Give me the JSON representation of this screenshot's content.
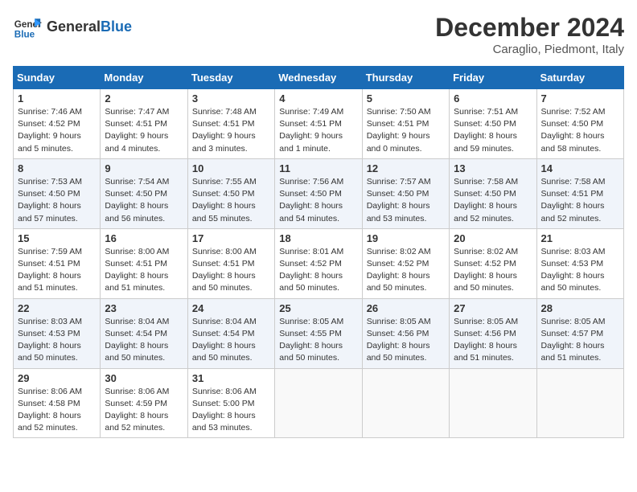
{
  "logo": {
    "text_general": "General",
    "text_blue": "Blue"
  },
  "title": "December 2024",
  "subtitle": "Caraglio, Piedmont, Italy",
  "days_of_week": [
    "Sunday",
    "Monday",
    "Tuesday",
    "Wednesday",
    "Thursday",
    "Friday",
    "Saturday"
  ],
  "weeks": [
    [
      {
        "day": "1",
        "sunrise": "7:46 AM",
        "sunset": "4:52 PM",
        "daylight": "9 hours and 5 minutes."
      },
      {
        "day": "2",
        "sunrise": "7:47 AM",
        "sunset": "4:51 PM",
        "daylight": "9 hours and 4 minutes."
      },
      {
        "day": "3",
        "sunrise": "7:48 AM",
        "sunset": "4:51 PM",
        "daylight": "9 hours and 3 minutes."
      },
      {
        "day": "4",
        "sunrise": "7:49 AM",
        "sunset": "4:51 PM",
        "daylight": "9 hours and 1 minute."
      },
      {
        "day": "5",
        "sunrise": "7:50 AM",
        "sunset": "4:51 PM",
        "daylight": "9 hours and 0 minutes."
      },
      {
        "day": "6",
        "sunrise": "7:51 AM",
        "sunset": "4:50 PM",
        "daylight": "8 hours and 59 minutes."
      },
      {
        "day": "7",
        "sunrise": "7:52 AM",
        "sunset": "4:50 PM",
        "daylight": "8 hours and 58 minutes."
      }
    ],
    [
      {
        "day": "8",
        "sunrise": "7:53 AM",
        "sunset": "4:50 PM",
        "daylight": "8 hours and 57 minutes."
      },
      {
        "day": "9",
        "sunrise": "7:54 AM",
        "sunset": "4:50 PM",
        "daylight": "8 hours and 56 minutes."
      },
      {
        "day": "10",
        "sunrise": "7:55 AM",
        "sunset": "4:50 PM",
        "daylight": "8 hours and 55 minutes."
      },
      {
        "day": "11",
        "sunrise": "7:56 AM",
        "sunset": "4:50 PM",
        "daylight": "8 hours and 54 minutes."
      },
      {
        "day": "12",
        "sunrise": "7:57 AM",
        "sunset": "4:50 PM",
        "daylight": "8 hours and 53 minutes."
      },
      {
        "day": "13",
        "sunrise": "7:58 AM",
        "sunset": "4:50 PM",
        "daylight": "8 hours and 52 minutes."
      },
      {
        "day": "14",
        "sunrise": "7:58 AM",
        "sunset": "4:51 PM",
        "daylight": "8 hours and 52 minutes."
      }
    ],
    [
      {
        "day": "15",
        "sunrise": "7:59 AM",
        "sunset": "4:51 PM",
        "daylight": "8 hours and 51 minutes."
      },
      {
        "day": "16",
        "sunrise": "8:00 AM",
        "sunset": "4:51 PM",
        "daylight": "8 hours and 51 minutes."
      },
      {
        "day": "17",
        "sunrise": "8:00 AM",
        "sunset": "4:51 PM",
        "daylight": "8 hours and 50 minutes."
      },
      {
        "day": "18",
        "sunrise": "8:01 AM",
        "sunset": "4:52 PM",
        "daylight": "8 hours and 50 minutes."
      },
      {
        "day": "19",
        "sunrise": "8:02 AM",
        "sunset": "4:52 PM",
        "daylight": "8 hours and 50 minutes."
      },
      {
        "day": "20",
        "sunrise": "8:02 AM",
        "sunset": "4:52 PM",
        "daylight": "8 hours and 50 minutes."
      },
      {
        "day": "21",
        "sunrise": "8:03 AM",
        "sunset": "4:53 PM",
        "daylight": "8 hours and 50 minutes."
      }
    ],
    [
      {
        "day": "22",
        "sunrise": "8:03 AM",
        "sunset": "4:53 PM",
        "daylight": "8 hours and 50 minutes."
      },
      {
        "day": "23",
        "sunrise": "8:04 AM",
        "sunset": "4:54 PM",
        "daylight": "8 hours and 50 minutes."
      },
      {
        "day": "24",
        "sunrise": "8:04 AM",
        "sunset": "4:54 PM",
        "daylight": "8 hours and 50 minutes."
      },
      {
        "day": "25",
        "sunrise": "8:05 AM",
        "sunset": "4:55 PM",
        "daylight": "8 hours and 50 minutes."
      },
      {
        "day": "26",
        "sunrise": "8:05 AM",
        "sunset": "4:56 PM",
        "daylight": "8 hours and 50 minutes."
      },
      {
        "day": "27",
        "sunrise": "8:05 AM",
        "sunset": "4:56 PM",
        "daylight": "8 hours and 51 minutes."
      },
      {
        "day": "28",
        "sunrise": "8:05 AM",
        "sunset": "4:57 PM",
        "daylight": "8 hours and 51 minutes."
      }
    ],
    [
      {
        "day": "29",
        "sunrise": "8:06 AM",
        "sunset": "4:58 PM",
        "daylight": "8 hours and 52 minutes."
      },
      {
        "day": "30",
        "sunrise": "8:06 AM",
        "sunset": "4:59 PM",
        "daylight": "8 hours and 52 minutes."
      },
      {
        "day": "31",
        "sunrise": "8:06 AM",
        "sunset": "5:00 PM",
        "daylight": "8 hours and 53 minutes."
      },
      null,
      null,
      null,
      null
    ]
  ],
  "labels": {
    "sunrise": "Sunrise:",
    "sunset": "Sunset:",
    "daylight": "Daylight:"
  }
}
